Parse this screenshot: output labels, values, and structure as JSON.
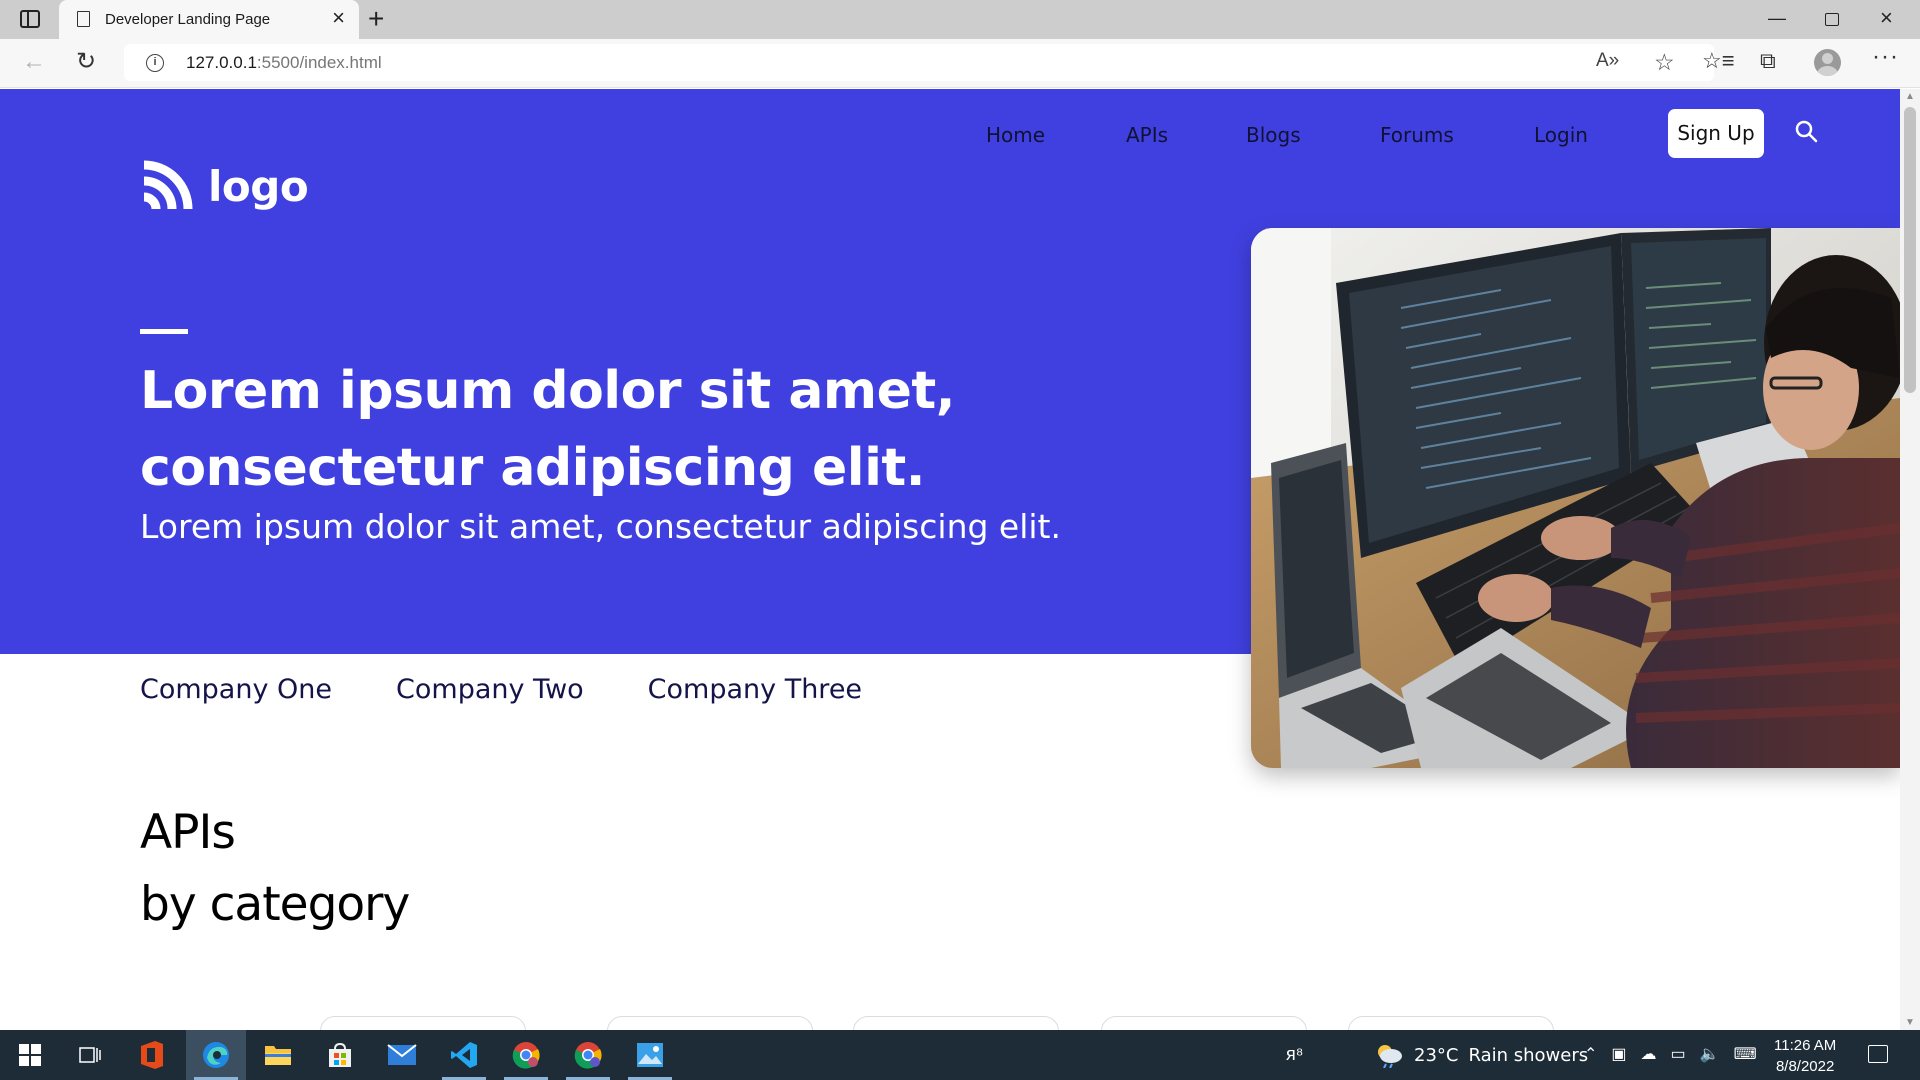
{
  "browser": {
    "tab_title": "Developer Landing Page",
    "url_host": "127.0.0.1",
    "url_path": ":5500/index.html"
  },
  "site": {
    "logo_text": "logo",
    "nav": [
      "Home",
      "APIs",
      "Blogs",
      "Forums",
      "Login"
    ],
    "signup_label": "Sign Up",
    "hero_headline": "Lorem ipsum dolor sit amet, consectetur adipiscing elit.",
    "hero_subtitle": "Lorem ipsum dolor sit amet, consectetur adipiscing elit.",
    "companies": [
      "Company One",
      "Company Two",
      "Company Three"
    ],
    "apis_heading_line1": "APIs",
    "apis_heading_line2": "by category",
    "colors": {
      "hero_bg": "#4040e0",
      "nav_text": "#111133",
      "company_text": "#14144a"
    }
  },
  "taskbar": {
    "weather_temp": "23°C",
    "weather_text": "Rain showers",
    "time": "11:26 AM",
    "date": "8/8/2022",
    "apps": [
      "office-icon",
      "edge-icon",
      "file-explorer-icon",
      "store-icon",
      "mail-icon",
      "vscode-icon",
      "chrome-icon",
      "chrome-icon",
      "photos-icon"
    ]
  }
}
